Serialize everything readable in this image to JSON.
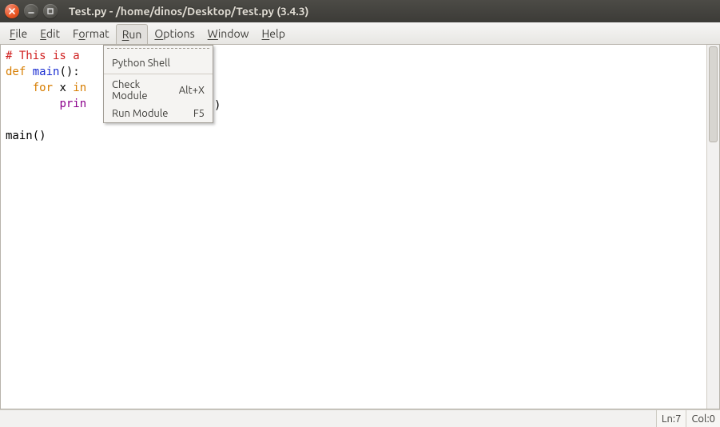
{
  "window": {
    "title": "Test.py - /home/dinos/Desktop/Test.py (3.4.3)"
  },
  "menus": {
    "file": {
      "label": "File",
      "ul": "F"
    },
    "edit": {
      "label": "Edit",
      "ul": "E"
    },
    "format": {
      "label": "Format",
      "ul": "o"
    },
    "run": {
      "label": "Run",
      "ul": "R"
    },
    "options": {
      "label": "Options",
      "ul": "O"
    },
    "window": {
      "label": "Window",
      "ul": "W"
    },
    "help": {
      "label": "Help",
      "ul": "H"
    }
  },
  "run_menu": {
    "python_shell": {
      "label": "Python Shell",
      "accel": ""
    },
    "check_module": {
      "label": "Check Module",
      "accel": "Alt+X"
    },
    "run_module": {
      "label": "Run Module",
      "accel": "F5"
    }
  },
  "code": {
    "line1_comment": "# This is a ",
    "line2_def": "def ",
    "line2_name": "main",
    "line2_rest": "():",
    "line3_indent": "    ",
    "line3_for": "for ",
    "line3_x": "x ",
    "line3_in": "in",
    "line4_indent": "        ",
    "line4_print": "prin",
    "line4_trailing": ")",
    "line6": "main()"
  },
  "status": {
    "ln_label": "Ln: ",
    "ln_value": "7",
    "col_label": "Col: ",
    "col_value": "0"
  }
}
